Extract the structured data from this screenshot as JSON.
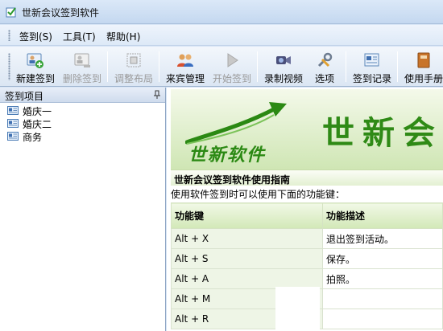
{
  "window": {
    "title": "世新会议签到软件"
  },
  "menu": [
    {
      "label": "签到(S)"
    },
    {
      "label": "工具(T)"
    },
    {
      "label": "帮助(H)"
    }
  ],
  "toolbar": [
    {
      "label": "新建签到",
      "icon": "add-user-icon",
      "enabled": true
    },
    {
      "label": "删除签到",
      "icon": "delete-user-icon",
      "enabled": false
    },
    {
      "label": "调整布局",
      "icon": "layout-icon",
      "enabled": false
    },
    {
      "label": "来宾管理",
      "icon": "guests-icon",
      "enabled": true
    },
    {
      "label": "开始签到",
      "icon": "play-icon",
      "enabled": false
    },
    {
      "label": "录制视频",
      "icon": "video-camera-icon",
      "enabled": true
    },
    {
      "label": "选项",
      "icon": "tools-icon",
      "enabled": true
    },
    {
      "label": "签到记录",
      "icon": "records-icon",
      "enabled": true
    },
    {
      "label": "使用手册",
      "icon": "manual-icon",
      "enabled": true
    }
  ],
  "panel": {
    "title": "签到项目",
    "items": [
      {
        "label": "婚庆一"
      },
      {
        "label": "婚庆二"
      },
      {
        "label": "商务"
      }
    ]
  },
  "content": {
    "banner_title": "世新会",
    "brand": "世新软件",
    "guide_title": "世新会议签到软件使用指南",
    "intro": "使用软件签到时可以使用下面的功能键：",
    "table": {
      "headers": [
        "功能键",
        "功能描述"
      ],
      "rows": [
        {
          "key": "Alt + X",
          "desc": "退出签到活动。"
        },
        {
          "key": "Alt + S",
          "desc": "保存。"
        },
        {
          "key": "Alt + A",
          "desc": "拍照。"
        },
        {
          "key": "Alt + M",
          "desc": ""
        },
        {
          "key": "Alt + R",
          "desc": ""
        }
      ]
    }
  },
  "colors": {
    "brand_green": "#2f8a16",
    "accent_blue": "#c4d8f0"
  }
}
